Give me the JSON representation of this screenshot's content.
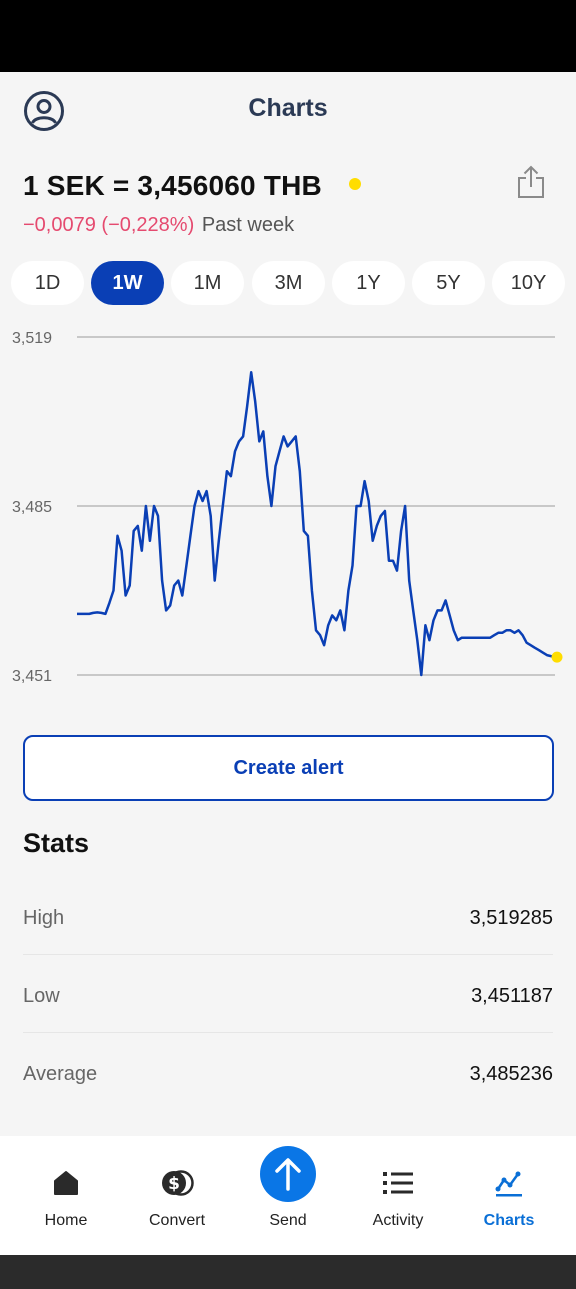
{
  "header": {
    "title": "Charts"
  },
  "rate": {
    "text": "1 SEK = 3,456060 THB",
    "change": "−0,0079 (−0,228%)",
    "period": "Past week",
    "live_color": "#ffdd00"
  },
  "range_tabs": {
    "items": [
      {
        "label": "1D"
      },
      {
        "label": "1W"
      },
      {
        "label": "1M"
      },
      {
        "label": "3M"
      },
      {
        "label": "1Y"
      },
      {
        "label": "5Y"
      },
      {
        "label": "10Y"
      }
    ],
    "selected": "1W"
  },
  "chart_data": {
    "type": "line",
    "ylim": [
      3.451,
      3.519
    ],
    "y_ticks": [
      "3,519",
      "3,485",
      "3,451"
    ],
    "grid": true,
    "line_color": "#0a3fb5",
    "end_marker_color": "#ffdd00",
    "series": [
      {
        "values": [
          3.4633,
          3.4633,
          3.4633,
          3.4633,
          3.4635,
          3.4636,
          3.4635,
          3.4633,
          3.4655,
          3.468,
          3.479,
          3.476,
          3.467,
          3.469,
          3.48,
          3.481,
          3.476,
          3.485,
          3.478,
          3.485,
          3.483,
          3.47,
          3.464,
          3.465,
          3.469,
          3.47,
          3.467,
          3.473,
          3.479,
          3.485,
          3.488,
          3.486,
          3.488,
          3.483,
          3.47,
          3.478,
          3.485,
          3.492,
          3.491,
          3.496,
          3.498,
          3.499,
          3.505,
          3.5119,
          3.506,
          3.498,
          3.5,
          3.491,
          3.485,
          3.493,
          3.496,
          3.499,
          3.497,
          3.498,
          3.499,
          3.492,
          3.48,
          3.479,
          3.468,
          3.46,
          3.459,
          3.457,
          3.461,
          3.463,
          3.462,
          3.464,
          3.46,
          3.468,
          3.473,
          3.485,
          3.485,
          3.49,
          3.486,
          3.478,
          3.481,
          3.483,
          3.484,
          3.474,
          3.474,
          3.472,
          3.48,
          3.485,
          3.47,
          3.464,
          3.458,
          3.451,
          3.461,
          3.458,
          3.462,
          3.464,
          3.464,
          3.466,
          3.463,
          3.46,
          3.458,
          3.4585,
          3.4585,
          3.4585,
          3.4585,
          3.4585,
          3.4585,
          3.4585,
          3.4585,
          3.459,
          3.4595,
          3.4595,
          3.46,
          3.46,
          3.4595,
          3.46,
          3.459,
          3.4575,
          3.457,
          3.4565,
          3.456,
          3.4555,
          3.455,
          3.4548,
          3.4546
        ]
      }
    ]
  },
  "actions": {
    "create_alert": "Create alert"
  },
  "stats": {
    "title": "Stats",
    "rows": [
      {
        "label": "High",
        "value": "3,519285"
      },
      {
        "label": "Low",
        "value": "3,451187"
      },
      {
        "label": "Average",
        "value": "3,485236"
      }
    ]
  },
  "bottom_nav": {
    "items": [
      {
        "label": "Home",
        "icon": "home-icon"
      },
      {
        "label": "Convert",
        "icon": "dollar-coins-icon"
      },
      {
        "label": "Send",
        "icon": "arrow-up-icon"
      },
      {
        "label": "Activity",
        "icon": "list-icon"
      },
      {
        "label": "Charts",
        "icon": "chart-line-icon"
      }
    ],
    "active": "Charts",
    "active_color": "#0a6fd6",
    "send_color": "#0a76e6"
  }
}
